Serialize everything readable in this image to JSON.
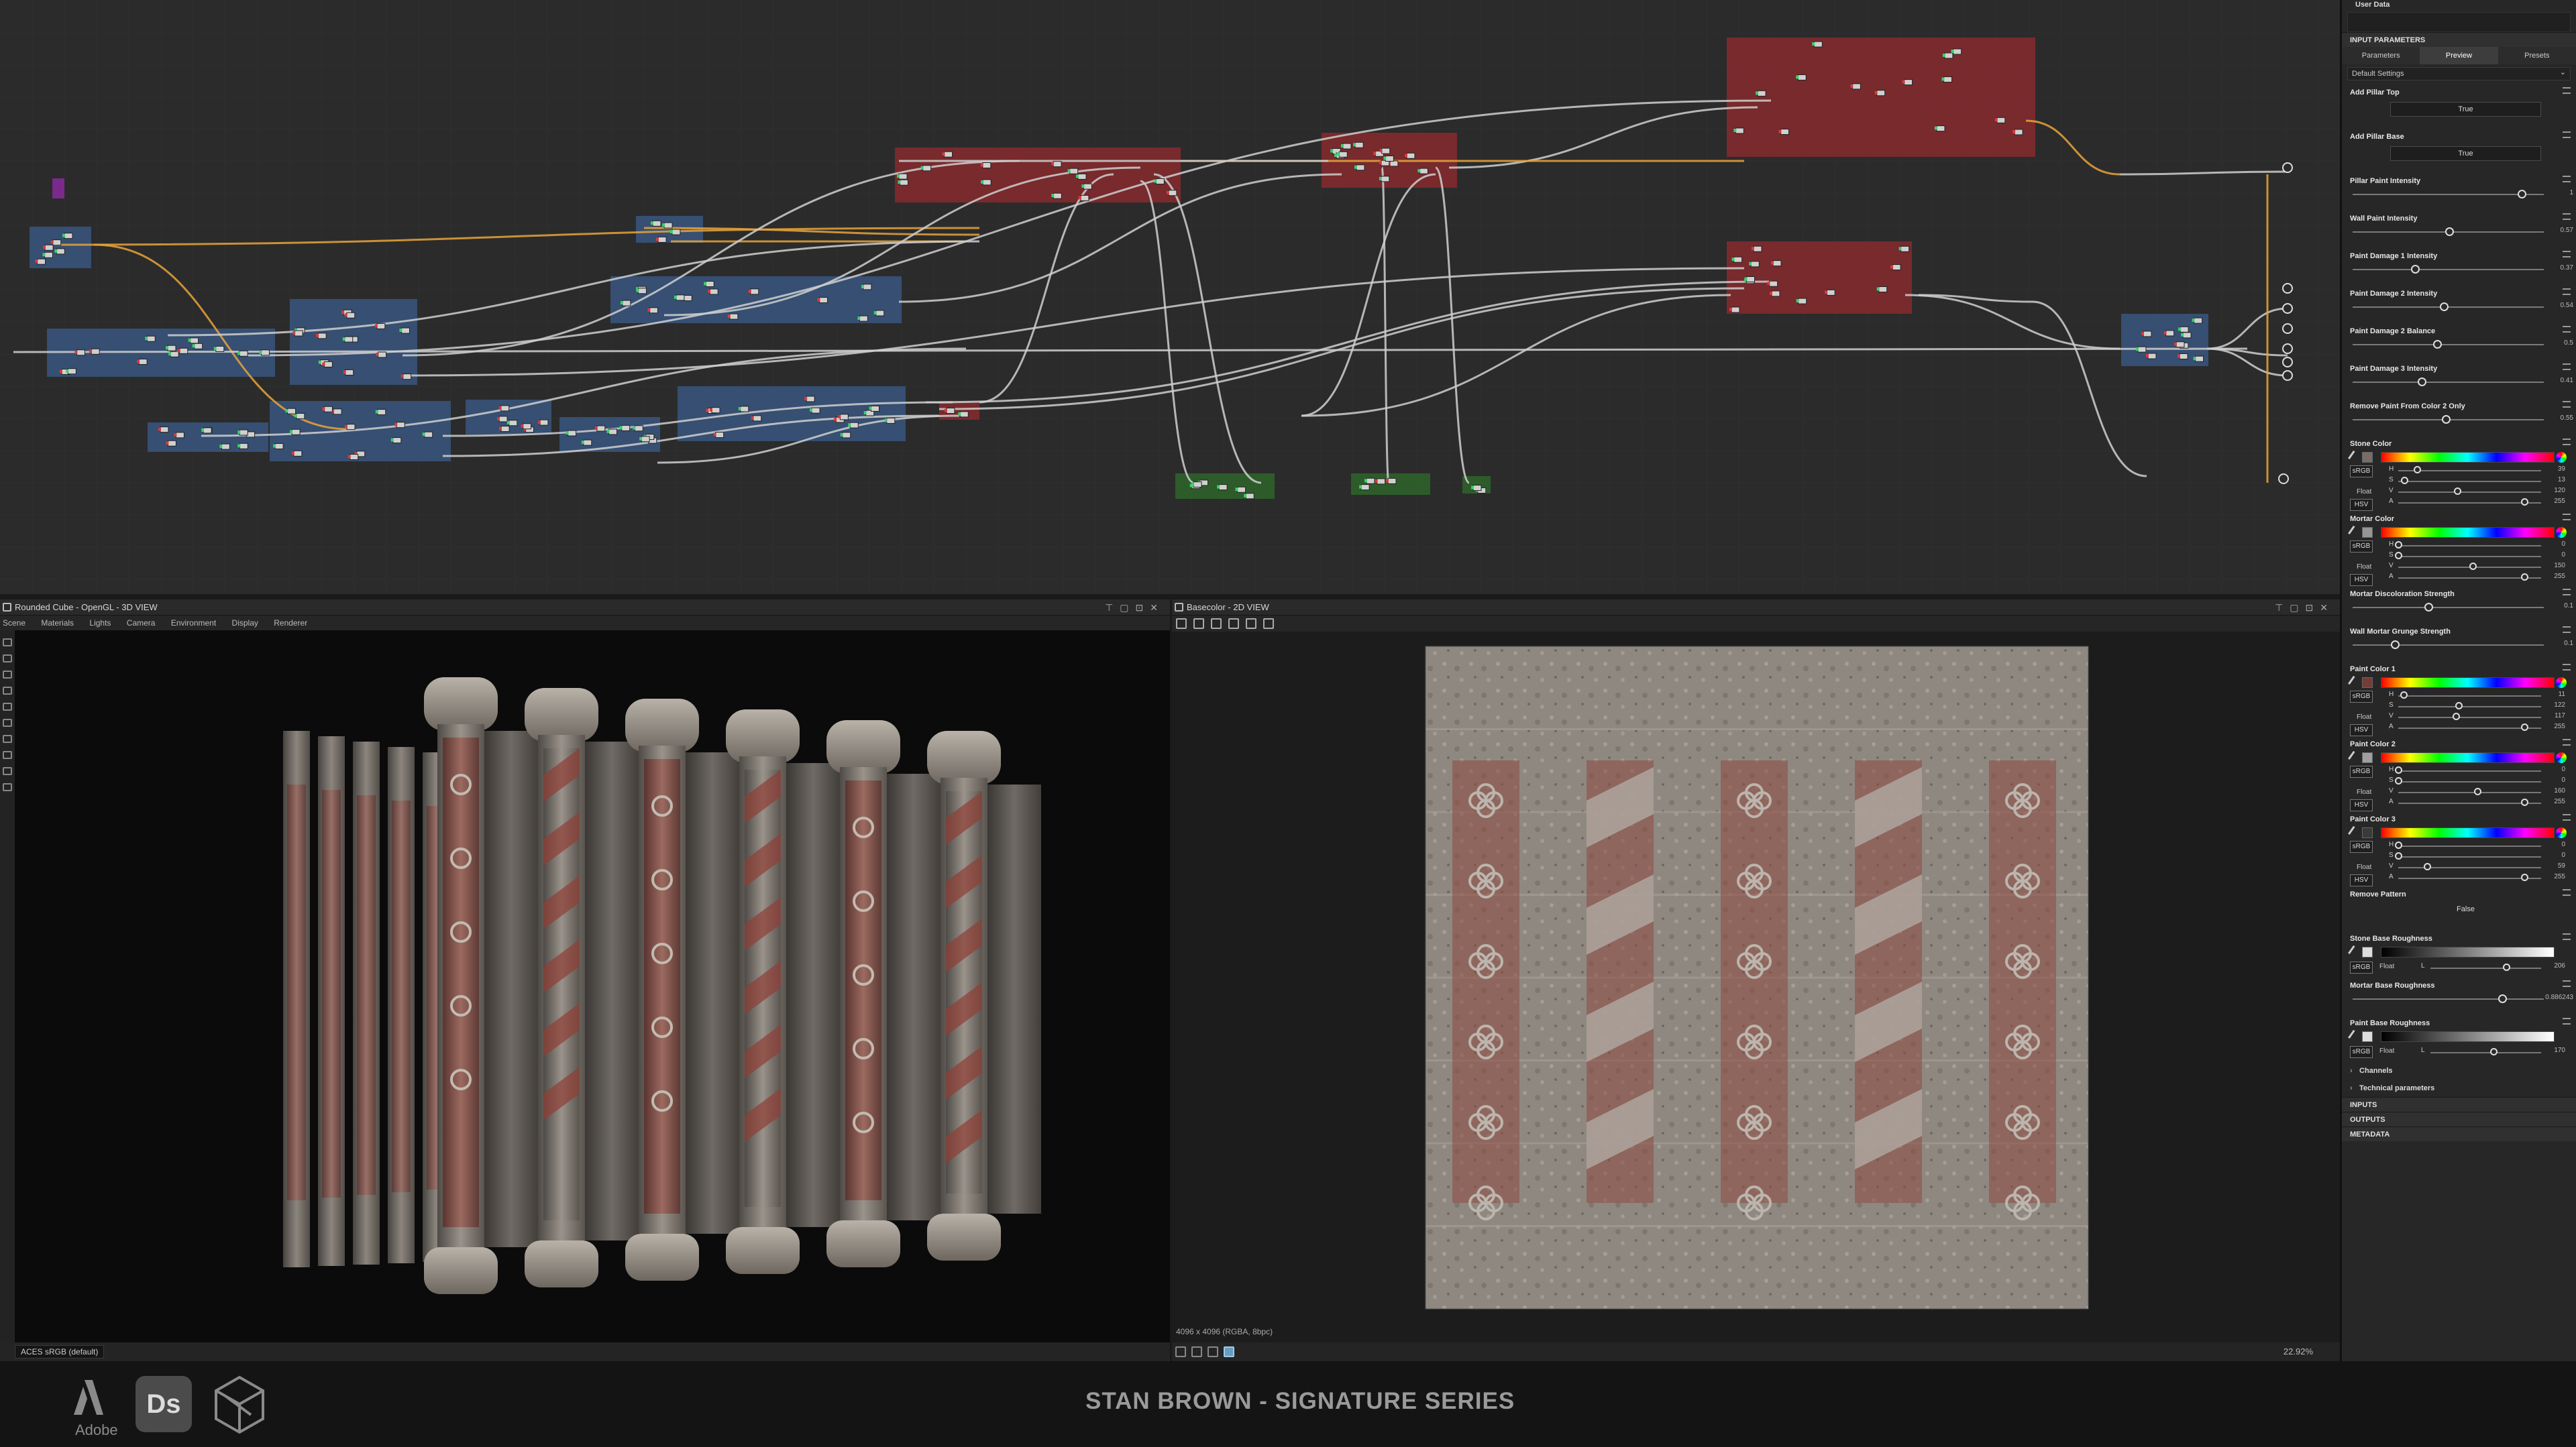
{
  "graph": {
    "frames": [
      {
        "name": "frame-blue",
        "color": "#3a5a86"
      },
      {
        "name": "frame-red",
        "color": "#8e2a2e"
      },
      {
        "name": "frame-green",
        "color": "#2e6a2a"
      }
    ],
    "link_colors": {
      "default": "#bdbdbd",
      "orange": "#e8a33a",
      "purple": "#8a3aa0"
    }
  },
  "view3d": {
    "title": "Rounded Cube - OpenGL - 3D VIEW",
    "menu": [
      "Scene",
      "Materials",
      "Lights",
      "Camera",
      "Environment",
      "Display",
      "Renderer"
    ],
    "colorspace": "ACES sRGB (default)",
    "title_icons": [
      "pin-icon",
      "restore-icon",
      "maximize-icon",
      "close-icon"
    ]
  },
  "view2d": {
    "title": "Basecolor - 2D VIEW",
    "resolution": "4096 x 4096 (RGBA, 8bpc)",
    "zoom": "22.92%",
    "toolbar_icons": [
      "fit-icon",
      "save-icon",
      "copy-icon",
      "export-icon",
      "info-icon",
      "histogram-icon"
    ],
    "title_icons": [
      "pin-icon",
      "restore-icon",
      "maximize-icon",
      "close-icon"
    ]
  },
  "props": {
    "user_data_label": "User Data",
    "input_parameters_label": "INPUT PARAMETERS",
    "tabs": [
      "Parameters",
      "Preview",
      "Presets"
    ],
    "active_tab": "Preview",
    "preset": "Default Settings",
    "bool_params": [
      {
        "label": "Add Pillar Top",
        "value": "True"
      },
      {
        "label": "Add Pillar Base",
        "value": "True"
      }
    ],
    "sliders": [
      {
        "label": "Pillar Paint Intensity",
        "value": "1",
        "pos": 1.0
      },
      {
        "label": "Wall Paint Intensity",
        "value": "0.57",
        "pos": 0.57
      },
      {
        "label": "Paint Damage 1 Intensity",
        "value": "0.37",
        "pos": 0.37
      },
      {
        "label": "Paint Damage 2 Intensity",
        "value": "0.54",
        "pos": 0.54
      },
      {
        "label": "Paint Damage 2 Balance",
        "value": "0.5",
        "pos": 0.5
      },
      {
        "label": "Paint Damage 3 Intensity",
        "value": "0.41",
        "pos": 0.41
      },
      {
        "label": "Remove Paint From Color 2 Only",
        "value": "0.55",
        "pos": 0.55
      }
    ],
    "stone_color": {
      "label": "Stone Color",
      "swatch": "#786e66",
      "h": "39",
      "s": "13",
      "v": "120",
      "a": "255",
      "hp": 0.15,
      "sp": 0.05,
      "vp": 0.47,
      "ap": 1.0
    },
    "mortar_color": {
      "label": "Mortar Color",
      "swatch": "#969696",
      "h": "0",
      "s": "0",
      "v": "150",
      "a": "255",
      "hp": 0,
      "sp": 0,
      "vp": 0.59,
      "ap": 1.0
    },
    "sliders2": [
      {
        "label": "Mortar Discoloration Strength",
        "value": "0.1",
        "pos": 0.45
      },
      {
        "label": "Wall Mortar Grunge Strength",
        "value": "0.1",
        "pos": 0.25
      }
    ],
    "paint1": {
      "label": "Paint Color 1",
      "swatch": "#753c38",
      "h": "11",
      "s": "122",
      "v": "117",
      "a": "255",
      "hp": 0.04,
      "sp": 0.48,
      "vp": 0.46,
      "ap": 1.0
    },
    "paint2": {
      "label": "Paint Color 2",
      "swatch": "#a0a0a0",
      "h": "0",
      "s": "0",
      "v": "160",
      "a": "255",
      "hp": 0,
      "sp": 0,
      "vp": 0.63,
      "ap": 1.0
    },
    "paint3": {
      "label": "Paint Color 3",
      "swatch": "#3a3a3a",
      "h": "0",
      "s": "0",
      "v": "59",
      "a": "255",
      "hp": 0,
      "sp": 0,
      "vp": 0.23,
      "ap": 1.0
    },
    "remove_pattern": {
      "label": "Remove Pattern",
      "value": "False"
    },
    "stone_rough": {
      "label": "Stone Base Roughness",
      "value": "206",
      "pos": 0.81
    },
    "mortar_rough": {
      "label": "Mortar Base Roughness",
      "value": "0.886243",
      "pos": 0.886
    },
    "paint_rough": {
      "label": "Paint Base Roughness",
      "value": "170",
      "pos": 0.67
    },
    "mode_labels": {
      "srgb": "sRGB",
      "float": "Float",
      "hsv": "HSV",
      "h": "H",
      "s": "S",
      "v": "V",
      "a": "A",
      "l": "L"
    },
    "groups": [
      "Channels",
      "Technical parameters"
    ],
    "sections": [
      "INPUTS",
      "OUTPUTS",
      "METADATA"
    ]
  },
  "footer": {
    "adobe": "Adobe",
    "ds": "Ds",
    "brand": "STAN BROWN - SIGNATURE SERIES"
  }
}
